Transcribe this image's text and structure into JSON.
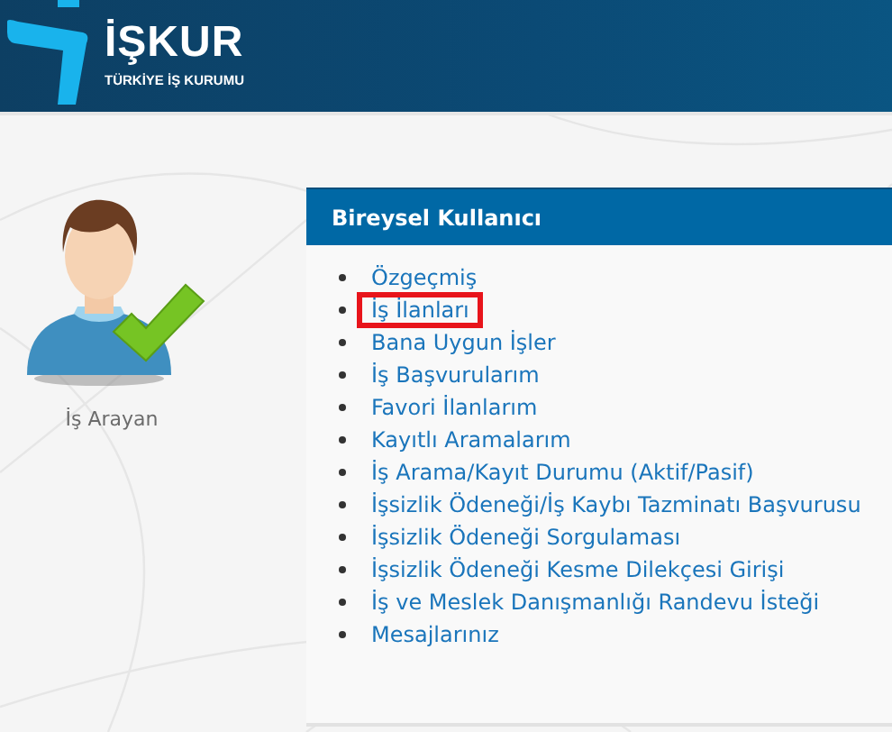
{
  "header": {
    "brand": "İŞKUR",
    "subtitle": "TÜRKİYE İŞ KURUMU"
  },
  "profile": {
    "label": "İş Arayan"
  },
  "panel": {
    "title": "Bireysel Kullanıcı",
    "items": [
      {
        "label": "Özgeçmiş",
        "highlighted": false
      },
      {
        "label": "İş İlanları",
        "highlighted": true
      },
      {
        "label": "Bana Uygun İşler",
        "highlighted": false
      },
      {
        "label": "İş Başvurularım",
        "highlighted": false
      },
      {
        "label": "Favori İlanlarım",
        "highlighted": false
      },
      {
        "label": "Kayıtlı Aramalarım",
        "highlighted": false
      },
      {
        "label": "İş Arama/Kayıt Durumu (Aktif/Pasif)",
        "highlighted": false
      },
      {
        "label": "İşsizlik Ödeneği/İş Kaybı Tazminatı Başvurusu",
        "highlighted": false
      },
      {
        "label": "İşsizlik Ödeneği Sorgulaması",
        "highlighted": false
      },
      {
        "label": "İşsizlik Ödeneği Kesme Dilekçesi Girişi",
        "highlighted": false
      },
      {
        "label": "İş ve Meslek Danışmanlığı Randevu İsteği",
        "highlighted": false
      },
      {
        "label": "Mesajlarınız",
        "highlighted": false
      }
    ]
  }
}
